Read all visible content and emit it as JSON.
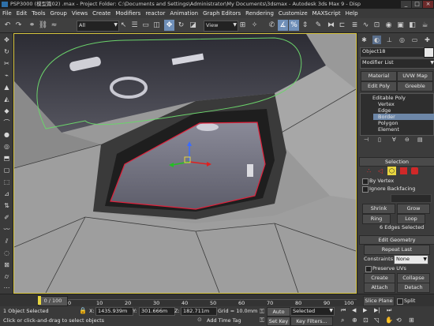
{
  "window": {
    "title": "PSP3000 (模型篇02) .max    - Project Folder: C:\\Documents and Settings\\Administrator\\My Documents\\3dsmax    - Autodesk 3ds Max 9    - Disp"
  },
  "menu": [
    "File",
    "Edit",
    "Tools",
    "Group",
    "Views",
    "Create",
    "Modifiers",
    "reactor",
    "Animation",
    "Graph Editors",
    "Rendering",
    "Customize",
    "MAXScript",
    "Help"
  ],
  "toolbar": {
    "selection_filter": "All",
    "ref_coord": "View"
  },
  "panel": {
    "object_name": "Object18",
    "modifier_list": "Modifier List",
    "buttons_row1": [
      "Material",
      "UVW Map"
    ],
    "buttons_row2": [
      "Edit Poly",
      "Greeble"
    ],
    "stack": [
      "Editable Poly",
      "Vertex",
      "Edge",
      "Border",
      "Polygon",
      "Element"
    ],
    "selection": {
      "header": "Selection",
      "by_vertex": "By Vertex",
      "ignore_backfacing": "Ignore Backfacing",
      "shrink": "Shrink",
      "grow": "Grow",
      "ring": "Ring",
      "loop": "Loop",
      "status": "6 Edges Selected"
    },
    "edit_geometry": {
      "header": "Edit Geometry",
      "repeat_last": "Repeat Last",
      "constraints_label": "Constraints:",
      "constraints_value": "None",
      "preserve_uvs": "Preserve UVs",
      "create": "Create",
      "collapse": "Collapse",
      "attach": "Attach",
      "detach": "Detach",
      "slice_plane": "Slice Plane",
      "split": "Split"
    }
  },
  "timeline": {
    "frame_counter": "0 / 100",
    "ticks": [
      "0",
      "10",
      "20",
      "30",
      "40",
      "50",
      "60",
      "70",
      "80",
      "90",
      "100"
    ]
  },
  "status": {
    "selected": "1 Object Selected",
    "prompt": "Click or click-and-drag to select objects",
    "x_label": "X:",
    "x_value": "1435.939m",
    "y_label": "Y:",
    "y_value": "301.666m",
    "z_label": "Z:",
    "z_value": "182.711m",
    "grid": "Grid = 10.0mm",
    "add_time_tag": "Add Time Tag",
    "auto_key": "Auto Key",
    "set_key": "Set Key",
    "key_mode": "Selected",
    "key_filters": "Key Filters..."
  },
  "colors": {
    "selected_edges": "#e0203a",
    "accent_stack": "#6d87a8",
    "viewport_border": "#d8c640"
  }
}
